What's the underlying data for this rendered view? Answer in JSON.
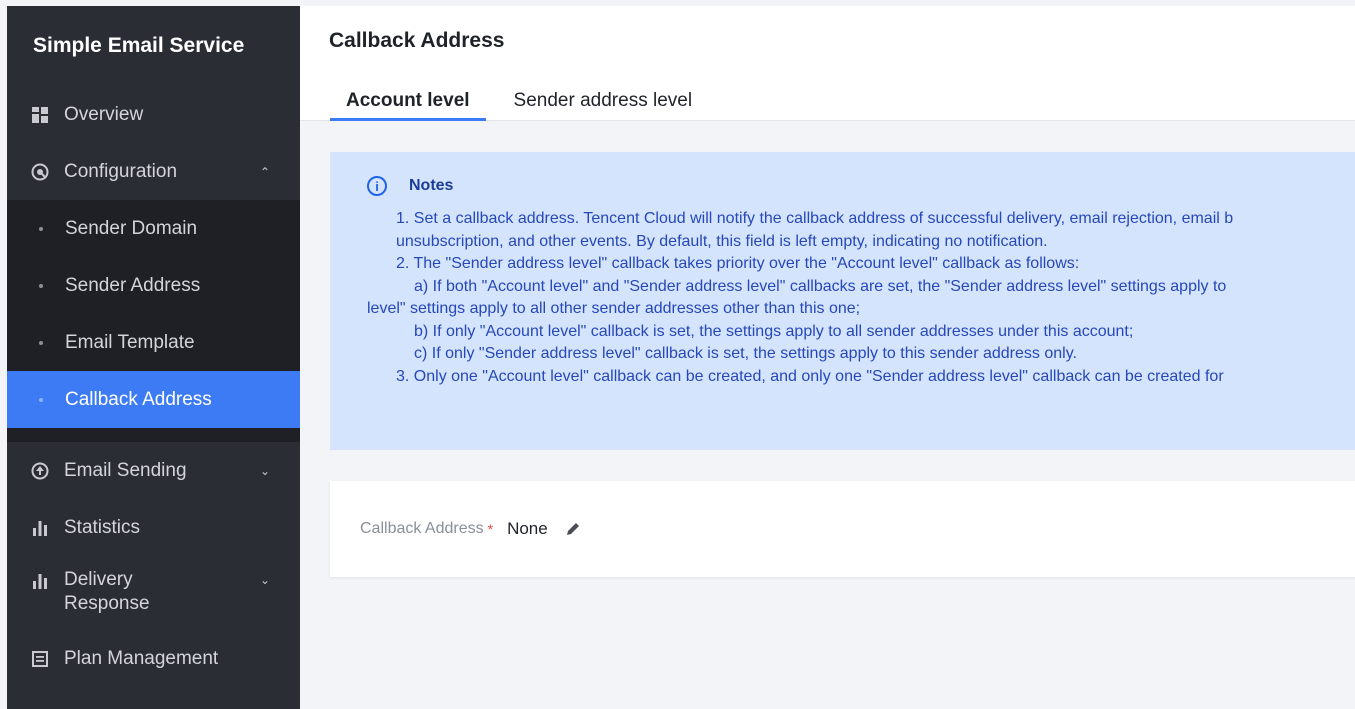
{
  "sidebar": {
    "title": "Simple Email Service",
    "overview": "Overview",
    "configuration": "Configuration",
    "config_items": [
      "Sender Domain",
      "Sender Address",
      "Email Template",
      "Callback Address"
    ],
    "email_sending": "Email Sending",
    "statistics": "Statistics",
    "delivery_response_1": "Delivery",
    "delivery_response_2": "Response",
    "plan_management": "Plan Management"
  },
  "header": {
    "title": "Callback Address",
    "tabs": [
      "Account level",
      "Sender address level"
    ]
  },
  "notes": {
    "title": "Notes",
    "lines": [
      "1. Set a callback address. Tencent Cloud will notify the callback address of successful delivery, email rejection, email b",
      "unsubscription, and other events. By default, this field is left empty, indicating no notification.",
      "2. The \"Sender address level\" callback takes priority over the \"Account level\" callback as follows:",
      "a) If both \"Account level\" and \"Sender address level\" callbacks are set, the \"Sender address level\" settings apply to",
      "level\" settings apply to all other sender addresses other than this one;",
      "b) If only \"Account level\" callback is set, the settings apply to all sender addresses under this account;",
      "c) If only \"Sender address level\" callback is set, the settings apply to this sender address only.",
      "3. Only one \"Account level\" callback can be created, and only one \"Sender address level\" callback can be created for"
    ]
  },
  "callback": {
    "label": "Callback Address",
    "required_mark": "*",
    "value": "None"
  },
  "colors": {
    "sidebar_bg": "#2b2d35",
    "active_bg": "#3d7bf5",
    "notes_bg": "#d5e4fd",
    "notes_text": "#2648b8"
  }
}
